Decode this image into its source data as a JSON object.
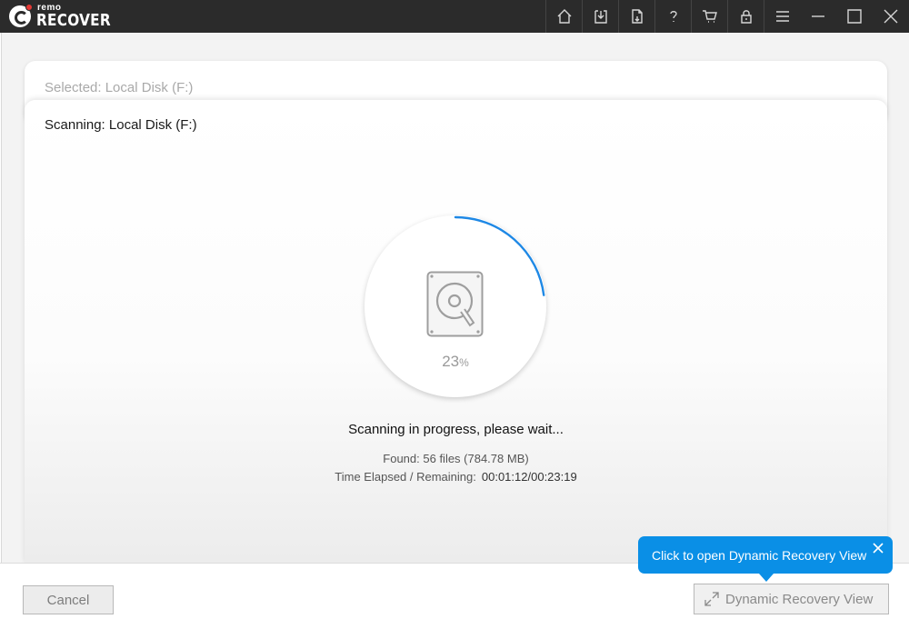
{
  "app": {
    "logo_small": "remo",
    "logo_big": "RECOVER",
    "brand_red": "#e53935",
    "accent": "#0a8fe6"
  },
  "titlebar": {
    "icons": [
      "home-icon",
      "download-icon",
      "file-export-icon",
      "help-icon",
      "cart-icon",
      "lock-icon",
      "menu-icon",
      "minimize-icon",
      "maximize-icon",
      "close-icon"
    ]
  },
  "selected": {
    "label": "Selected: Local Disk (F:)"
  },
  "scan": {
    "title": "Scanning: Local Disk (F:)",
    "progress_value": "23",
    "progress_unit": "%",
    "progress_fraction": 0.23,
    "status": "Scanning in progress, please wait...",
    "found": "Found: 56 files (784.78 MB)",
    "time_label": "Time Elapsed / Remaining:",
    "time_elapsed": "00:01:12",
    "time_sep": "/",
    "time_remaining": "00:23:19"
  },
  "buttons": {
    "cancel": "Cancel",
    "dynamic_recovery_view": "Dynamic Recovery View"
  },
  "tooltip": {
    "text": "Click to open Dynamic Recovery View"
  }
}
